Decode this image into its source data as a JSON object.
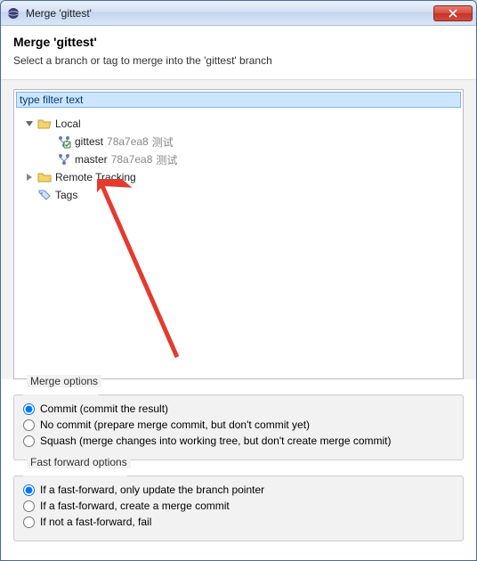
{
  "window": {
    "title": "Merge 'gittest'"
  },
  "header": {
    "title": "Merge 'gittest'",
    "subtitle": "Select a branch or tag to merge into the 'gittest' branch"
  },
  "filter": {
    "placeholder": "type filter text",
    "value": "type filter text"
  },
  "tree": {
    "local": {
      "label": "Local",
      "expanded": true,
      "children": [
        {
          "name": "gittest",
          "hash": "78a7ea8",
          "note": "测试",
          "checked": true
        },
        {
          "name": "master",
          "hash": "78a7ea8",
          "note": "测试",
          "checked": false
        }
      ]
    },
    "remote": {
      "label": "Remote Tracking",
      "expanded": false
    },
    "tags": {
      "label": "Tags",
      "expanded": false
    }
  },
  "mergeOptions": {
    "legend": "Merge options",
    "items": [
      {
        "label": "Commit (commit the result)",
        "selected": true
      },
      {
        "label": "No commit (prepare merge commit, but don't commit yet)",
        "selected": false
      },
      {
        "label": "Squash (merge changes into working tree, but don't create merge commit)",
        "selected": false
      }
    ]
  },
  "ffOptions": {
    "legend": "Fast forward options",
    "items": [
      {
        "label": "If a fast-forward, only update the branch pointer",
        "selected": true
      },
      {
        "label": "If a fast-forward, create a merge commit",
        "selected": false
      },
      {
        "label": "If not a fast-forward, fail",
        "selected": false
      }
    ]
  }
}
